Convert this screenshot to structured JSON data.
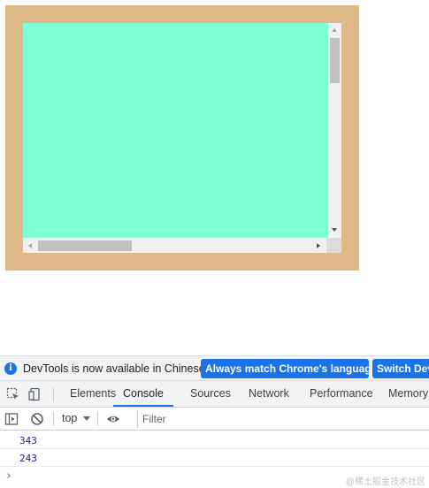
{
  "demo": {
    "outer_color": "#deb887",
    "inner_color": "#7fffd4"
  },
  "devtools": {
    "infobar": {
      "message": "DevTools is now available in Chinese!",
      "match_button": "Always match Chrome's language",
      "switch_button": "Switch Dev"
    },
    "tabs": {
      "elements": "Elements",
      "console": "Console",
      "sources": "Sources",
      "network": "Network",
      "performance": "Performance",
      "memory": "Memory"
    },
    "toolbar": {
      "context": "top",
      "filter_placeholder": "Filter"
    },
    "console_output": [
      "343",
      "243"
    ],
    "prompt": "›"
  },
  "watermark": "@稀土掘金技术社区",
  "icons": [
    "inspect-icon",
    "device-toggle-icon",
    "sidebar-icon",
    "clear-console-icon",
    "eye-icon",
    "info-icon"
  ]
}
